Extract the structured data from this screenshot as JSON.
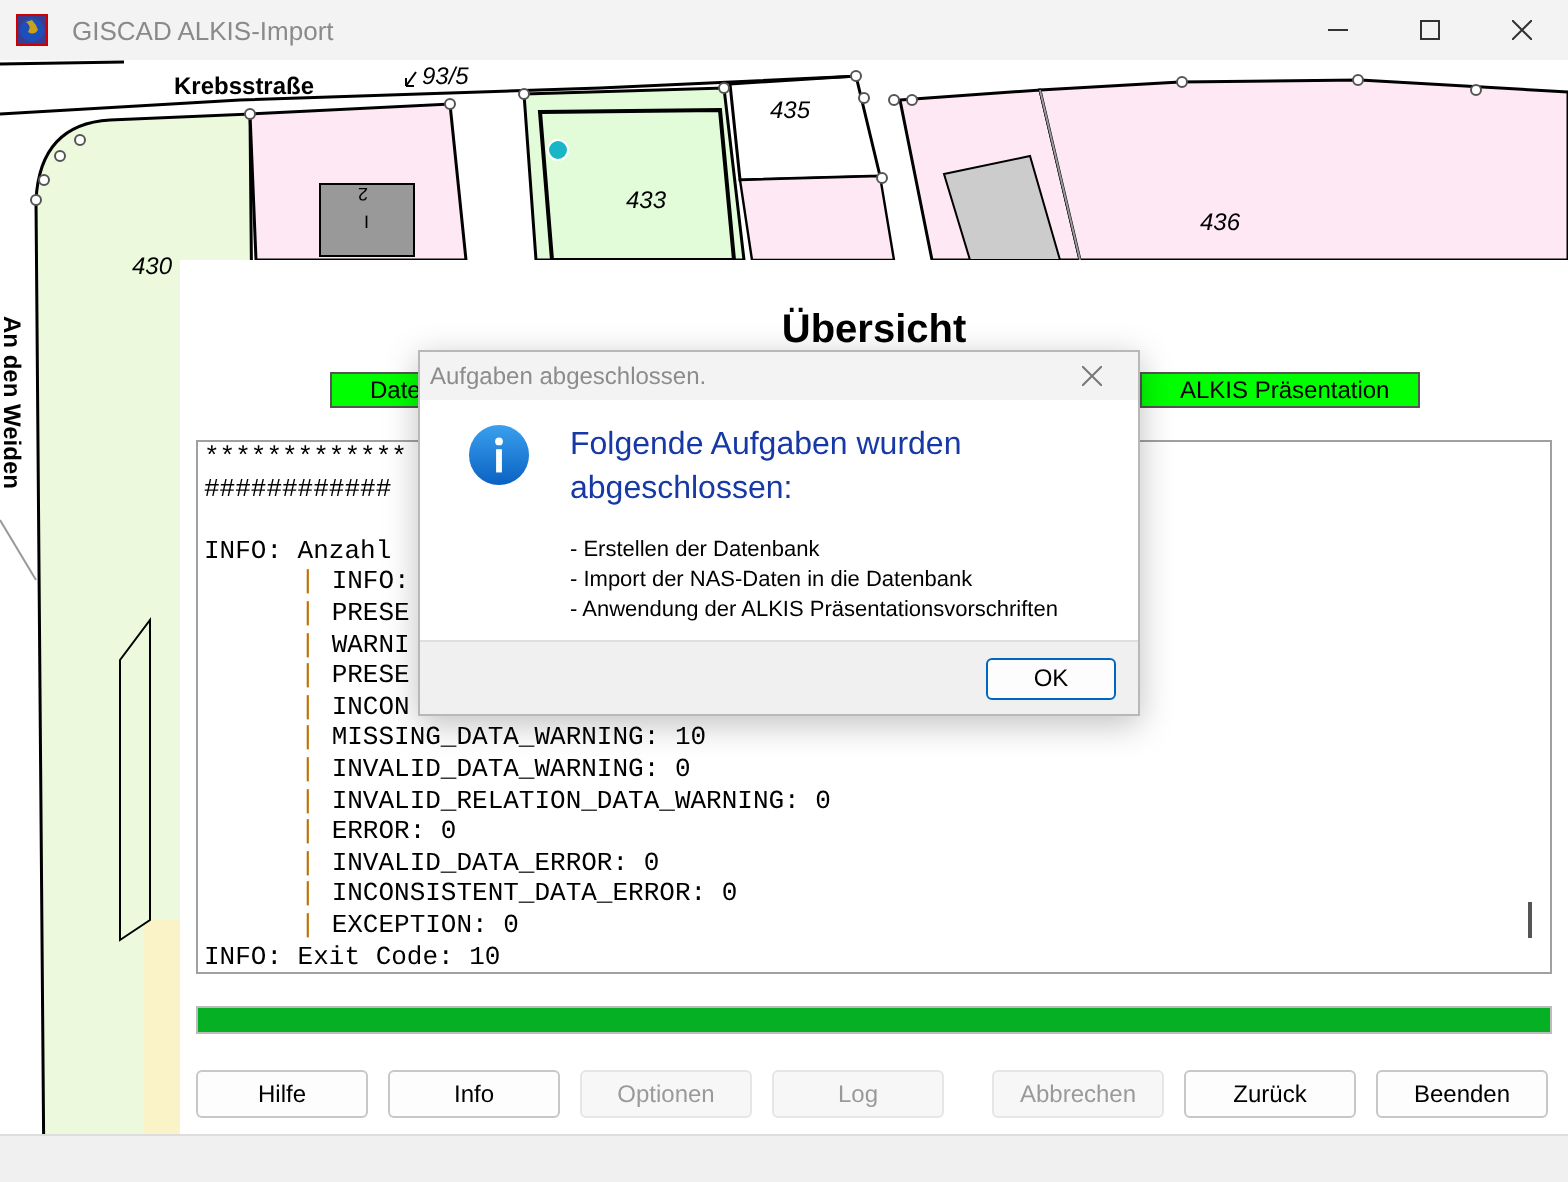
{
  "window": {
    "title": "GISCAD ALKIS-Import"
  },
  "map": {
    "labels": [
      {
        "kind": "street",
        "text": "Krebsstraße"
      },
      {
        "kind": "parcel",
        "text": "93/5"
      },
      {
        "kind": "parcel",
        "text": "435"
      },
      {
        "kind": "parcel",
        "text": "433"
      },
      {
        "kind": "parcel",
        "text": "436"
      },
      {
        "kind": "parcel",
        "text": "430"
      },
      {
        "kind": "street",
        "text": "An den Weiden"
      },
      {
        "kind": "building",
        "text": "2"
      },
      {
        "kind": "building",
        "text": "I"
      }
    ]
  },
  "panel": {
    "title": "Übersicht",
    "steps": [
      {
        "label": "Date",
        "done": true
      },
      {
        "label": "ALKIS Präsentation",
        "done": true
      }
    ],
    "log": [
      {
        "kind": "head",
        "text": "*************"
      },
      {
        "kind": "head",
        "text": "############"
      },
      {
        "kind": "blank"
      },
      {
        "kind": "head",
        "text": "INFO: Anzahl"
      },
      {
        "kind": "sub",
        "marker": "|",
        "text": "INFO:"
      },
      {
        "kind": "sub",
        "marker": "|",
        "text": "PRESE"
      },
      {
        "kind": "sub",
        "marker": "|",
        "text": "WARNI"
      },
      {
        "kind": "sub",
        "marker": "|",
        "text": "PRESE"
      },
      {
        "kind": "sub",
        "marker": "|",
        "text": "INCON"
      },
      {
        "kind": "sub",
        "marker": "|",
        "text": "MISSING_DATA_WARNING: 10"
      },
      {
        "kind": "sub",
        "marker": "|",
        "text": "INVALID_DATA_WARNING: 0"
      },
      {
        "kind": "sub",
        "marker": "|",
        "text": "INVALID_RELATION_DATA_WARNING: 0"
      },
      {
        "kind": "sub",
        "marker": "|",
        "text": "ERROR: 0"
      },
      {
        "kind": "sub",
        "marker": "|",
        "text": "INVALID_DATA_ERROR: 0"
      },
      {
        "kind": "sub",
        "marker": "|",
        "text": "INCONSISTENT_DATA_ERROR: 0"
      },
      {
        "kind": "sub",
        "marker": "|",
        "text": "EXCEPTION: 0"
      },
      {
        "kind": "head",
        "text": "INFO: Exit Code: 10"
      }
    ],
    "progress": {
      "level": 1
    },
    "buttons": [
      {
        "label": "Hilfe",
        "disabled": false
      },
      {
        "label": "Info",
        "disabled": false
      },
      {
        "label": "Optionen",
        "disabled": true
      },
      {
        "label": "Log",
        "disabled": true
      },
      {
        "label": "Abbrechen",
        "disabled": true
      },
      {
        "label": "Zurück",
        "disabled": false
      },
      {
        "label": "Beenden",
        "disabled": false
      }
    ]
  },
  "dialog": {
    "title": "Aufgaben abgeschlossen.",
    "heading": "Folgende Aufgaben wurden abgeschlossen:",
    "items": [
      "- Erstellen der Datenbank",
      "- Import der NAS-Daten in die Datenbank",
      "- Anwendung der ALKIS Präsentationsvorschriften"
    ],
    "button": "OK"
  }
}
